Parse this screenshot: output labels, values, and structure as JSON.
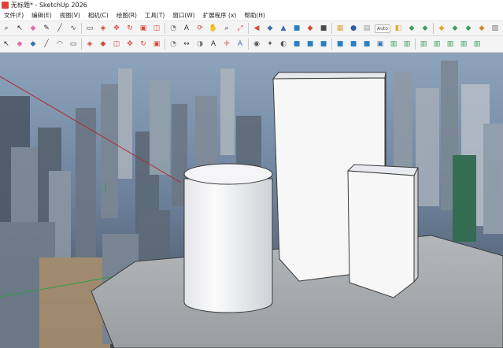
{
  "window": {
    "title": "无标题* - SketchUp 2026"
  },
  "menu": {
    "items": [
      {
        "label": "文件(F)"
      },
      {
        "label": "编辑(E)"
      },
      {
        "label": "视图(V)"
      },
      {
        "label": "相机(C)"
      },
      {
        "label": "绘图(R)"
      },
      {
        "label": "工具(T)"
      },
      {
        "label": "窗口(W)"
      },
      {
        "label": "扩展程序 (x)"
      },
      {
        "label": "帮助(H)"
      }
    ]
  },
  "toolbar": {
    "row1": [
      {
        "icon": "search-icon",
        "glyph": "⌕",
        "color": "#333333"
      },
      {
        "icon": "select-arrow-icon",
        "glyph": "↖",
        "color": "#222222"
      },
      {
        "icon": "eraser-icon",
        "glyph": "◆",
        "color": "#e46aa8"
      },
      {
        "icon": "pencil-icon",
        "glyph": "✎",
        "color": "#333333"
      },
      {
        "icon": "line-icon",
        "glyph": "╱",
        "color": "#444444"
      },
      {
        "icon": "freehand-icon",
        "glyph": "∿",
        "color": "#444444"
      },
      {
        "icon": "rectangle-icon",
        "glyph": "▭",
        "color": "#444444"
      },
      {
        "icon": "push-pull-icon",
        "glyph": "◈",
        "color": "#d24b3a"
      },
      {
        "icon": "move-icon",
        "glyph": "✥",
        "color": "#d24b3a"
      },
      {
        "icon": "rotate-icon",
        "glyph": "↻",
        "color": "#d24b3a"
      },
      {
        "icon": "scale-icon",
        "glyph": "▣",
        "color": "#d24b3a"
      },
      {
        "icon": "offset-icon",
        "glyph": "◫",
        "color": "#d24b3a"
      },
      {
        "icon": "tape-measure-icon",
        "glyph": "◔",
        "color": "#777777"
      },
      {
        "icon": "text-icon",
        "glyph": "A",
        "color": "#333333"
      },
      {
        "icon": "orbit-icon",
        "glyph": "⟳",
        "color": "#d24b3a"
      },
      {
        "icon": "pan-icon",
        "glyph": "✋",
        "color": "#c9882e"
      },
      {
        "icon": "zoom-icon",
        "glyph": "⌕",
        "color": "#333333"
      },
      {
        "icon": "zoom-extents-icon",
        "glyph": "⤢",
        "color": "#d24b3a"
      },
      {
        "icon": "previous-view-icon",
        "glyph": "◀",
        "color": "#d24b3a"
      },
      {
        "icon": "paint-bucket-icon",
        "glyph": "◆",
        "color": "#3a6fb5"
      },
      {
        "icon": "components-icon",
        "glyph": "▲",
        "color": "#3a6fb5"
      },
      {
        "icon": "warehouse-icon",
        "glyph": "■",
        "color": "#2b7fc4"
      },
      {
        "icon": "extension-icon",
        "glyph": "◆",
        "color": "#c94a3a"
      },
      {
        "icon": "style-icon",
        "glyph": "■",
        "color": "#4a4a4a"
      },
      {
        "icon": "sandbox-icon",
        "glyph": "▦",
        "color": "#e0a83a"
      },
      {
        "icon": "shadow-icon",
        "glyph": "●",
        "color": "#2b5c9b"
      },
      {
        "icon": "fog-icon",
        "glyph": "▤",
        "color": "#999999"
      },
      {
        "icon": "section-icon",
        "glyph": "◧",
        "color": "#e0a83a"
      },
      {
        "icon": "iso-view-icon",
        "glyph": "◆",
        "color": "#3aa05a"
      },
      {
        "icon": "top-view-icon",
        "glyph": "◆",
        "color": "#3aa05a"
      },
      {
        "icon": "front-view-icon",
        "glyph": "◆",
        "color": "#e0a83a"
      },
      {
        "icon": "right-view-icon",
        "glyph": "◆",
        "color": "#3aa05a"
      },
      {
        "icon": "back-view-icon",
        "glyph": "◆",
        "color": "#3aa05a"
      },
      {
        "icon": "left-view-icon",
        "glyph": "◆",
        "color": "#c98a2e"
      },
      {
        "icon": "wireframe-icon",
        "glyph": "▧",
        "color": "#777777"
      },
      {
        "icon": "eyedropper-icon",
        "glyph": "✎",
        "color": "#c94a3a"
      },
      {
        "icon": "sun-icon",
        "glyph": "☼",
        "color": "#e0a83a"
      },
      {
        "icon": "layers-icon",
        "glyph": "▦",
        "color": "#666666"
      },
      {
        "icon": "match-photo-icon",
        "glyph": "◈",
        "color": "#c94a3a"
      },
      {
        "icon": "warehouse-upload-icon",
        "glyph": "▲",
        "color": "#3a6fb5"
      },
      {
        "icon": "settings-icon",
        "glyph": "⚙",
        "color": "#666666"
      }
    ],
    "row1_badge": "Auto",
    "row2": [
      {
        "icon": "select-icon",
        "glyph": "↖",
        "color": "#222222"
      },
      {
        "icon": "eraser-icon",
        "glyph": "◆",
        "color": "#e46aa8"
      },
      {
        "icon": "paint-icon",
        "glyph": "◆",
        "color": "#3a6fb5"
      },
      {
        "icon": "line-icon",
        "glyph": "╱",
        "color": "#444444"
      },
      {
        "icon": "arc-icon",
        "glyph": "◠",
        "color": "#444444"
      },
      {
        "icon": "shape-icon",
        "glyph": "▭",
        "color": "#444444"
      },
      {
        "icon": "push-pull-icon",
        "glyph": "◈",
        "color": "#d24b3a"
      },
      {
        "icon": "follow-me-icon",
        "glyph": "◆",
        "color": "#d24b3a"
      },
      {
        "icon": "offset-icon",
        "glyph": "◫",
        "color": "#d24b3a"
      },
      {
        "icon": "move-icon",
        "glyph": "✥",
        "color": "#d24b3a"
      },
      {
        "icon": "rotate-icon",
        "glyph": "↻",
        "color": "#d24b3a"
      },
      {
        "icon": "scale-icon",
        "glyph": "▣",
        "color": "#d24b3a"
      },
      {
        "icon": "tape-measure-icon",
        "glyph": "◔",
        "color": "#777777"
      },
      {
        "icon": "dimension-icon",
        "glyph": "↔",
        "color": "#444444"
      },
      {
        "icon": "protractor-icon",
        "glyph": "◑",
        "color": "#777777"
      },
      {
        "icon": "text-icon",
        "glyph": "A",
        "color": "#333333"
      },
      {
        "icon": "axes-icon",
        "glyph": "✛",
        "color": "#d24b3a"
      },
      {
        "icon": "3d-text-icon",
        "glyph": "A",
        "color": "#3a6fb5"
      },
      {
        "icon": "eye-icon",
        "glyph": "◉",
        "color": "#555555"
      },
      {
        "icon": "walk-icon",
        "glyph": "✦",
        "color": "#555555"
      },
      {
        "icon": "look-around-icon",
        "glyph": "◐",
        "color": "#555555"
      },
      {
        "icon": "solid-tools-icon",
        "glyph": "■",
        "color": "#2b7fc4"
      },
      {
        "icon": "intersect-icon",
        "glyph": "■",
        "color": "#2b7fc4"
      },
      {
        "icon": "union-icon",
        "glyph": "■",
        "color": "#2b7fc4"
      },
      {
        "icon": "subtract-icon",
        "glyph": "■",
        "color": "#2b7fc4"
      },
      {
        "icon": "trim-icon",
        "glyph": "■",
        "color": "#2b7fc4"
      },
      {
        "icon": "split-icon",
        "glyph": "■",
        "color": "#2b7fc4"
      },
      {
        "icon": "group-icon",
        "glyph": "▣",
        "color": "#3a6fb5"
      },
      {
        "icon": "scene-icon",
        "glyph": "▥",
        "color": "#3aa05a"
      },
      {
        "icon": "scene-2-icon",
        "glyph": "▥",
        "color": "#3aa05a"
      },
      {
        "icon": "scene-3-icon",
        "glyph": "▥",
        "color": "#3aa05a"
      },
      {
        "icon": "scene-4-icon",
        "glyph": "▥",
        "color": "#3aa05a"
      },
      {
        "icon": "scene-5-icon",
        "glyph": "▥",
        "color": "#3aa05a"
      },
      {
        "icon": "scene-6-icon",
        "glyph": "▥",
        "color": "#3aa05a"
      },
      {
        "icon": "scene-7-icon",
        "glyph": "▥",
        "color": "#3aa05a"
      }
    ]
  },
  "viewport": {
    "sky_color": "#6f88a6",
    "ground_color": "#a7abad",
    "model_face_color": "#f2f2f4",
    "model_shade_color": "#cfd1d6",
    "edge_color": "#3a3a3a",
    "axis_red": "#b22b2b",
    "axis_green": "#2f9b46"
  }
}
